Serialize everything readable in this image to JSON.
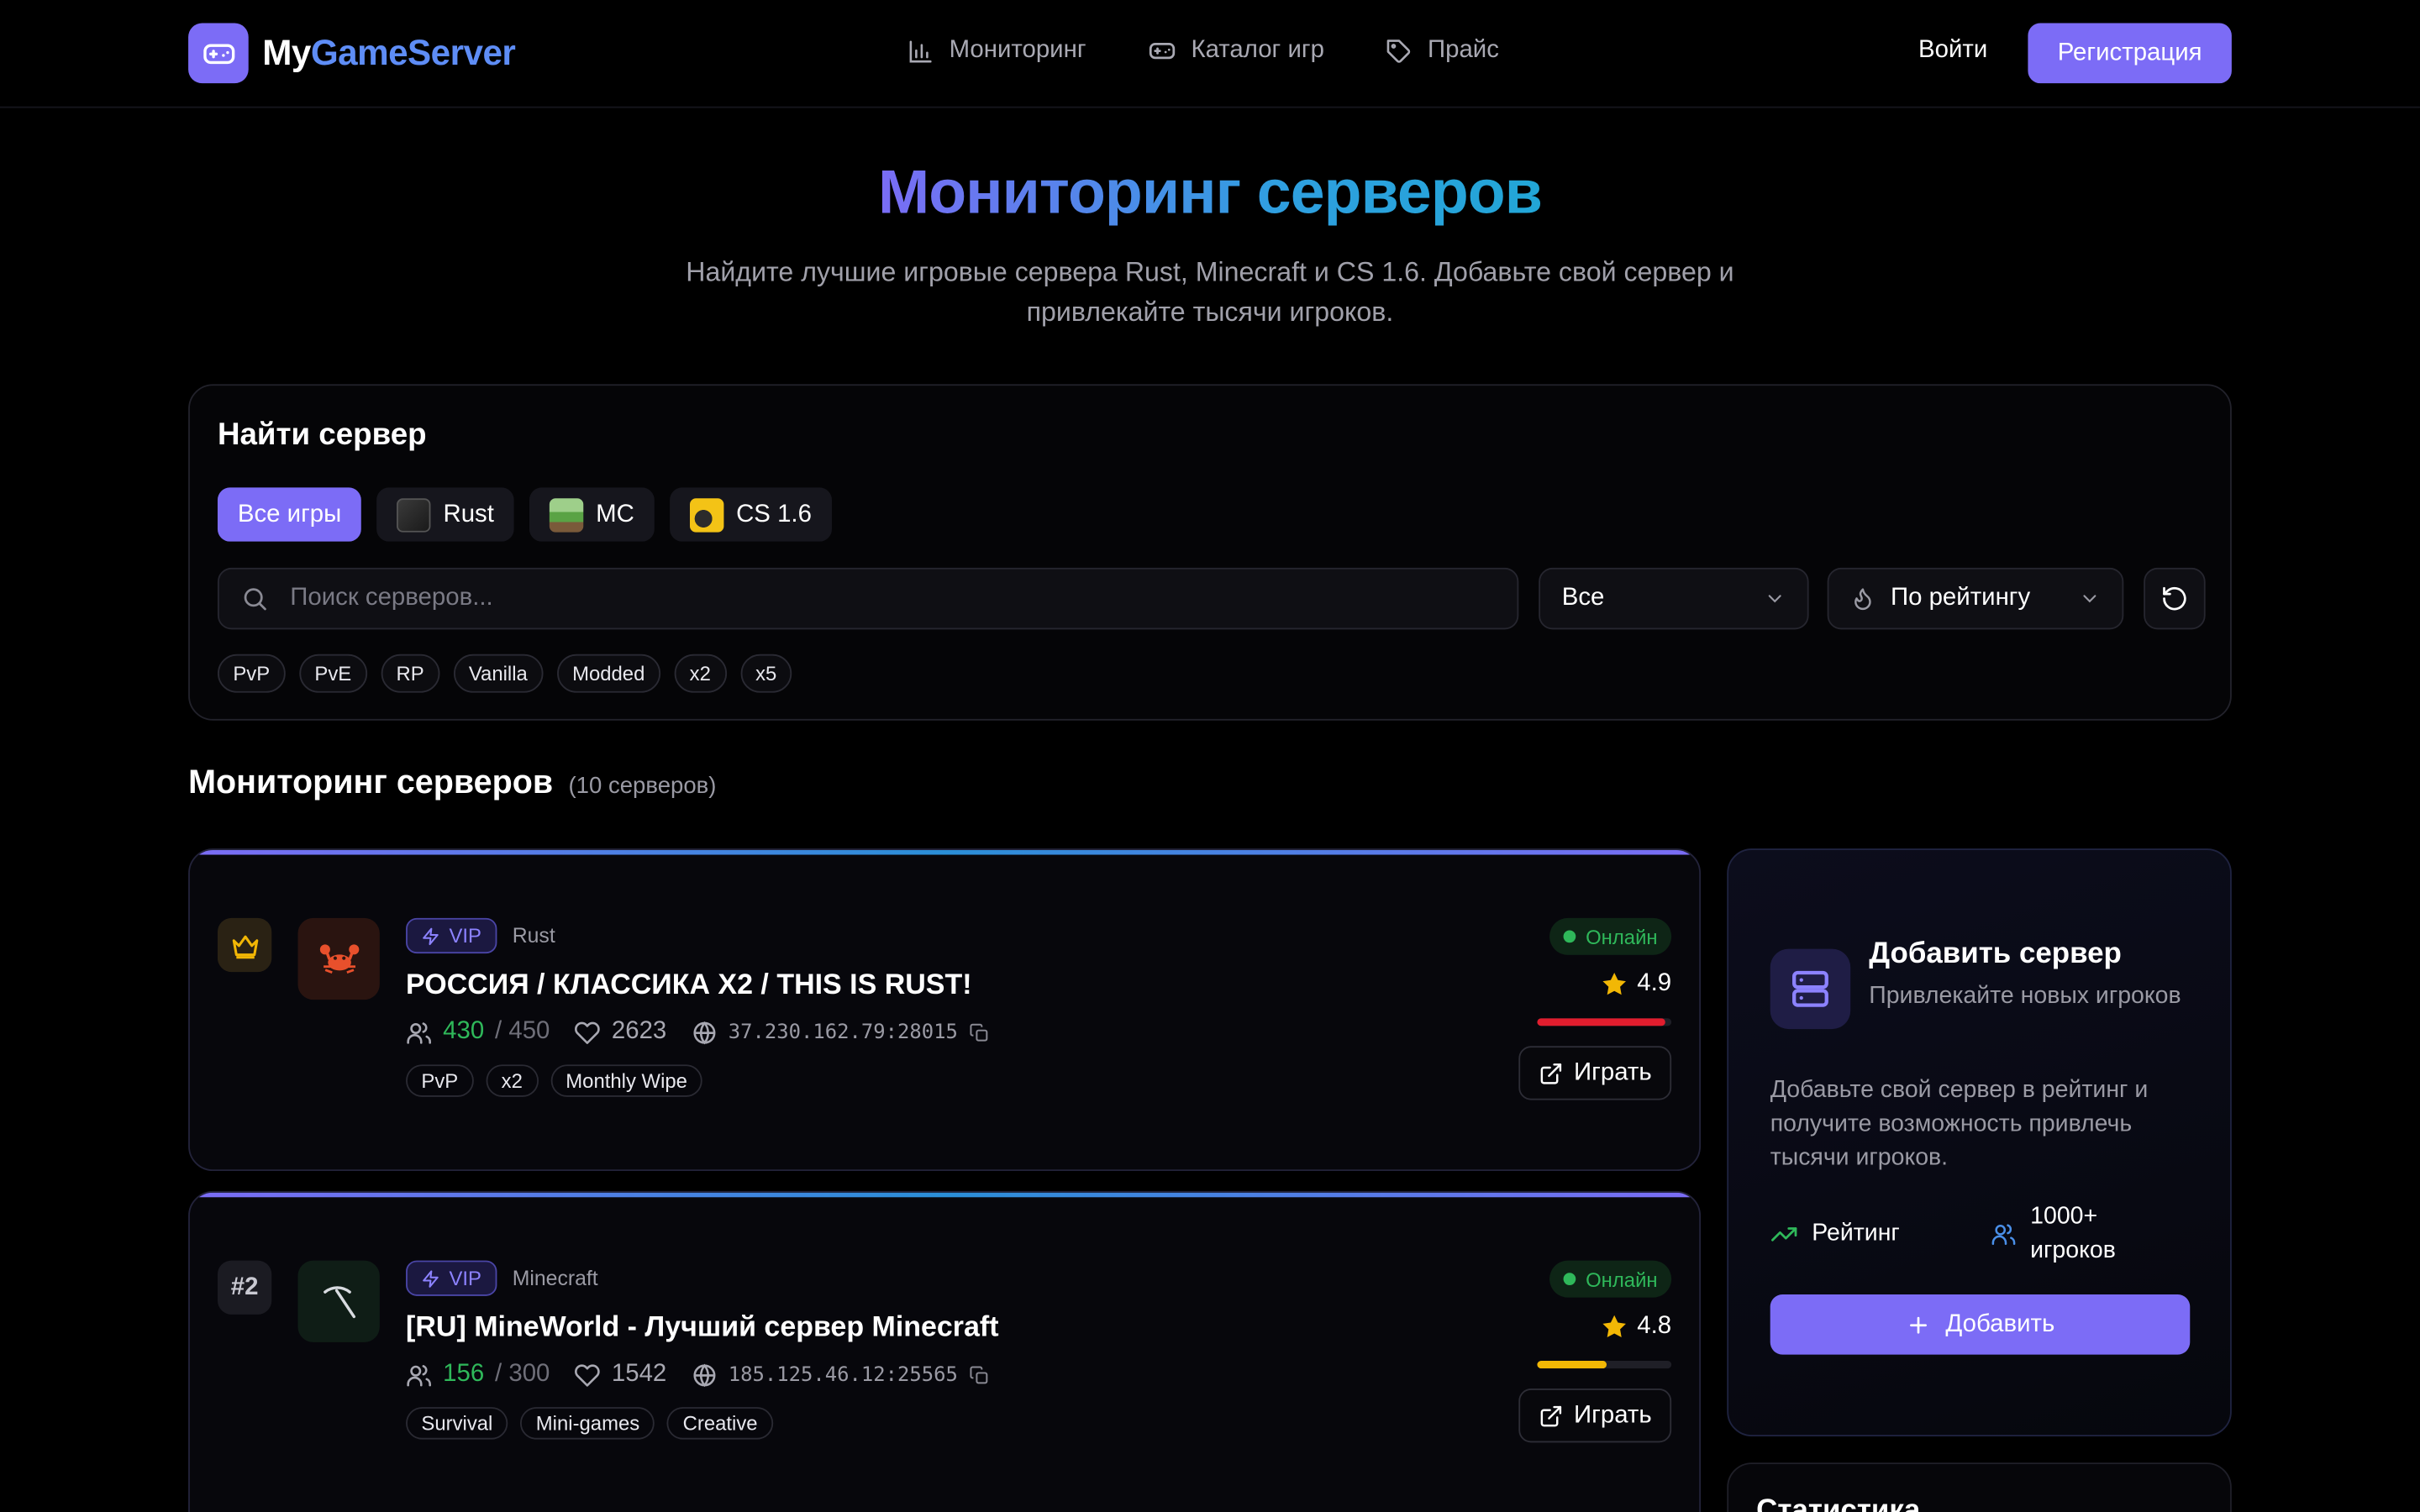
{
  "header": {
    "logo_part1": "My",
    "logo_part2": "GameServer",
    "nav": [
      {
        "label": "Мониторинг",
        "icon": "bar-chart-icon"
      },
      {
        "label": "Каталог игр",
        "icon": "gamepad-icon"
      },
      {
        "label": "Прайс",
        "icon": "tag-icon"
      }
    ],
    "login": "Войти",
    "signup": "Регистрация"
  },
  "hero": {
    "title": "Мониторинг серверов",
    "subtitle": "Найдите лучшие игровые сервера Rust, Minecraft и CS 1.6. Добавьте свой сервер и привлекайте тысячи игроков."
  },
  "search_panel": {
    "title": "Найти сервер",
    "games": [
      {
        "label": "Все игры",
        "active": true
      },
      {
        "label": "Rust",
        "active": false
      },
      {
        "label": "MC",
        "active": false
      },
      {
        "label": "CS 1.6",
        "active": false
      }
    ],
    "search_placeholder": "Поиск серверов...",
    "filter_value": "Все",
    "sort_value": "По рейтингу",
    "tags": [
      "PvP",
      "PvE",
      "RP",
      "Vanilla",
      "Modded",
      "x2",
      "x5"
    ]
  },
  "section": {
    "title": "Мониторинг серверов",
    "count": "(10 серверов)"
  },
  "servers": [
    {
      "rank": "",
      "vip": "VIP",
      "game": "Rust",
      "name": "РОССИЯ / КЛАССИКА X2 / THIS IS RUST!",
      "online": "430",
      "max": "/ 450",
      "likes": "2623",
      "ip": "37.230.162.79:28015",
      "tags": [
        "PvP",
        "x2",
        "Monthly Wipe"
      ],
      "status": "Онлайн",
      "rating": "4.9",
      "rating_fill": 0.95,
      "bar_color": "#e11d2e",
      "play": "Играть"
    },
    {
      "rank": "#2",
      "vip": "VIP",
      "game": "Minecraft",
      "name": "[RU] MineWorld - Лучший сервер Minecraft",
      "online": "156",
      "max": "/ 300",
      "likes": "1542",
      "ip": "185.125.46.12:25565",
      "tags": [
        "Survival",
        "Mini-games",
        "Creative"
      ],
      "status": "Онлайн",
      "rating": "4.8",
      "rating_fill": 0.52,
      "bar_color": "#f2b705",
      "play": "Играть"
    }
  ],
  "sidebar": {
    "title": "Добавить сервер",
    "subtitle": "Привлекайте новых игроков",
    "description": "Добавьте свой сервер в рейтинг и получите возможность привлечь тысячи игроков.",
    "feature1": "Рейтинг",
    "feature2": "1000+ игроков",
    "button": "Добавить",
    "stats_title": "Статистика"
  },
  "colors": {
    "accent": "#7c6cf6",
    "online": "#2fb85a",
    "logo_blue": "#5e8df6"
  }
}
